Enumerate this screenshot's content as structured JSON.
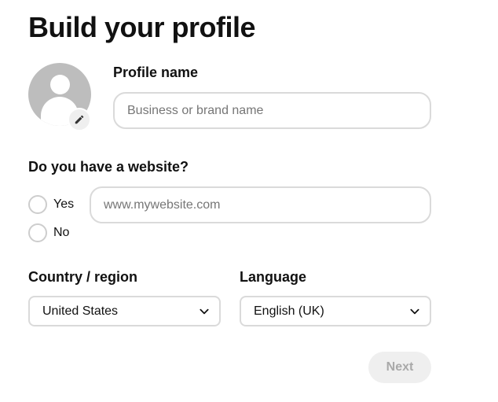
{
  "page": {
    "title": "Build your profile"
  },
  "profile": {
    "avatar_icon": "default-user-avatar",
    "edit_icon": "pencil-icon",
    "name_label": "Profile name",
    "name_placeholder": "Business or brand name",
    "name_value": ""
  },
  "website": {
    "question": "Do you have a website?",
    "options": [
      {
        "label": "Yes",
        "selected": false
      },
      {
        "label": "No",
        "selected": false
      }
    ],
    "url_placeholder": "www.mywebsite.com",
    "url_value": ""
  },
  "country": {
    "label": "Country / region",
    "selected": "United States"
  },
  "language": {
    "label": "Language",
    "selected": "English (UK)"
  },
  "actions": {
    "next_label": "Next",
    "next_enabled": false
  },
  "colors": {
    "text": "#111111",
    "placeholder": "#767676",
    "border": "#dadada",
    "avatar_bg": "#bdbdbd",
    "button_disabled_bg": "#efefef",
    "button_disabled_text": "#a9a9a9"
  }
}
